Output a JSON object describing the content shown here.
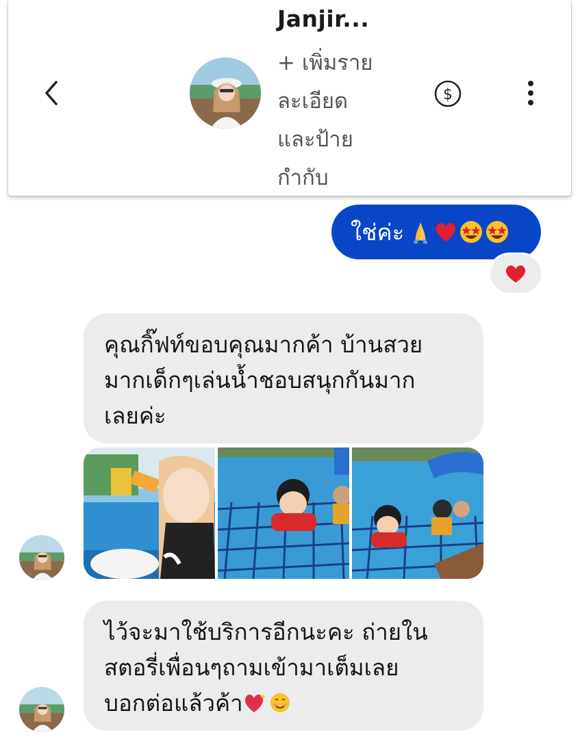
{
  "header": {
    "contact_name": "Janjir...",
    "subtitle_lines": [
      "+ เพิ่มราย",
      "ละเอียด",
      "และป้าย",
      "กำกับ"
    ],
    "back_icon": "chevron-left-icon",
    "payment_icon": "dollar-circle-icon",
    "menu_icon": "more-vertical-icon"
  },
  "messages": {
    "sent_1": {
      "text": "ใช่ค่ะ",
      "emojis": [
        "folded-hands",
        "red-heart",
        "star-struck",
        "star-struck"
      ],
      "reaction": "red-heart"
    },
    "received_1": {
      "lines": [
        "คุณกิ๊ฟท์ขอบคุณมากค้า บ้านสวย",
        "มากเด็กๆเล่นน้ำชอบสนุกกันมาก",
        "เลยค่ะ"
      ]
    },
    "received_2": {
      "lines": [
        "ไว้จะมาใช้บริการอีกนะคะ ถ่ายใน",
        "สตอรี่เพื่อนๆถามเข้ามาเต็มเลย",
        "บอกต่อแล้วค้า"
      ],
      "trailing_emojis": [
        "sparkling-heart",
        "smiling-face"
      ]
    }
  },
  "colors": {
    "sent_bubble": "#0a46c8",
    "received_bubble": "#ececec",
    "heart": "#e0202e"
  }
}
